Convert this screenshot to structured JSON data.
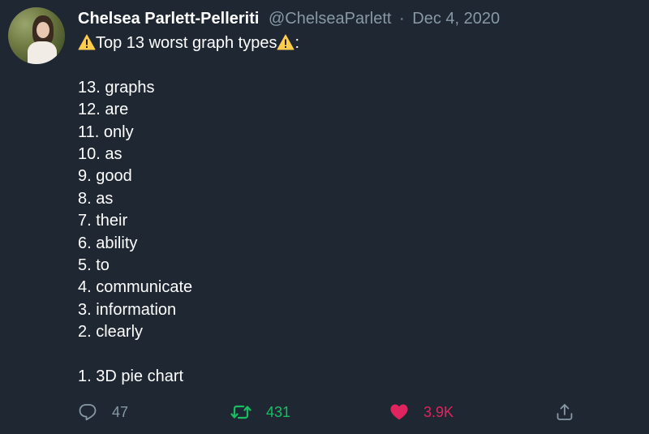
{
  "tweet": {
    "author": {
      "display_name": "Chelsea Parlett-Pelleriti",
      "handle": "@ChelseaParlett",
      "date": "Dec 4, 2020",
      "separator": "·"
    },
    "title_text": "Top 13 worst graph types",
    "title_suffix": ":",
    "lines": [
      "13. graphs",
      "12. are",
      "11. only",
      "10. as",
      "9. good",
      "8. as",
      "7. their",
      "6. ability",
      "5. to",
      "4. communicate",
      "3. information",
      "2. clearly",
      "",
      "1. 3D pie chart"
    ],
    "stats": {
      "replies": "47",
      "retweets": "431",
      "likes": "3.9K"
    }
  },
  "icons": {
    "warning": "warning-icon",
    "reply": "reply-icon",
    "retweet": "retweet-icon",
    "like": "heart-icon",
    "share": "share-icon"
  },
  "colors": {
    "background": "#1e2732",
    "text": "#ffffff",
    "secondary": "#8899a6",
    "retweet": "#17bf63",
    "like": "#e0245e",
    "warning": "#ffcc4d"
  }
}
